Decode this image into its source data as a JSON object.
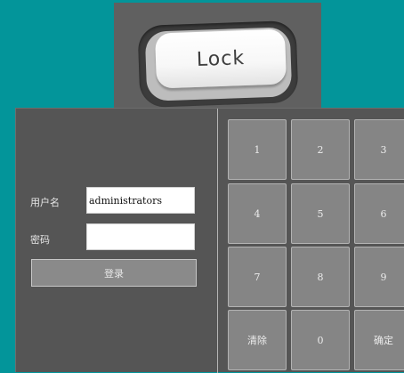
{
  "lock_button": {
    "label": "Lock"
  },
  "login_form": {
    "username_label": "用户名",
    "username_value": "administrators",
    "password_label": "密码",
    "password_value": "",
    "login_button_label": "登录"
  },
  "keypad": {
    "keys": [
      "1",
      "2",
      "3",
      "4",
      "5",
      "6",
      "7",
      "8",
      "9",
      "清除",
      "0",
      "确定"
    ]
  },
  "colors": {
    "background": "#03959a",
    "panel": "#555555",
    "key": "#858585"
  }
}
